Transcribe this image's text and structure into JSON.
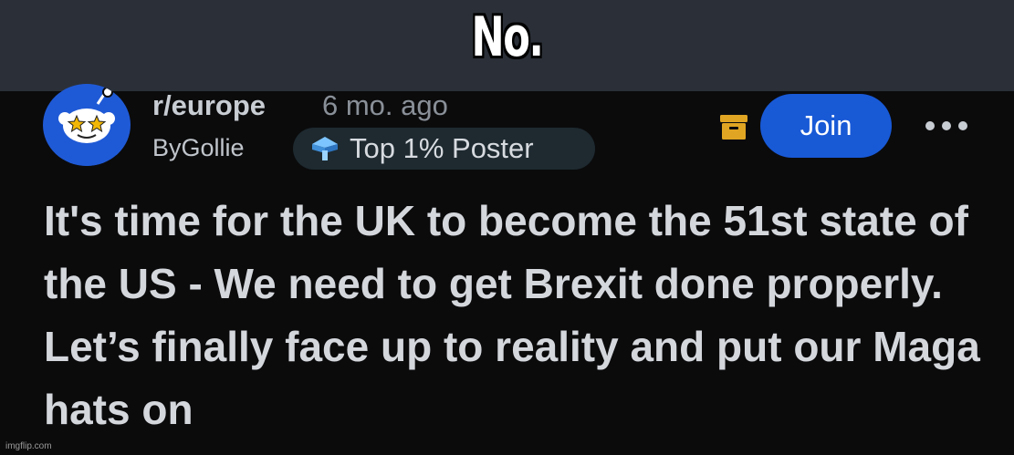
{
  "caption": {
    "text": "No."
  },
  "post": {
    "subreddit": "r/europe",
    "age": "6 mo. ago",
    "author": "ByGollie",
    "flair": "Top 1% Poster",
    "join_label": "Join",
    "title": "It's time for the UK to become the 51st state of the US - We need to get Brexit done properly. Let’s finally face up to reality and put our Maga hats on"
  },
  "watermark": {
    "text": "imgflip.com"
  },
  "icons": {
    "avatar": "reddit-snoo-star-eyes-icon",
    "flair": "top-poster-badge-icon",
    "archive": "archive-icon",
    "more": "more-options-icon"
  },
  "colors": {
    "caption_bg": "#2b3038",
    "page_bg": "#0b0b0c",
    "join_button": "#1859d6",
    "avatar_bg": "#1f5ad6",
    "archive_icon": "#e0a523",
    "flair_icon": "#4aa3ff"
  }
}
